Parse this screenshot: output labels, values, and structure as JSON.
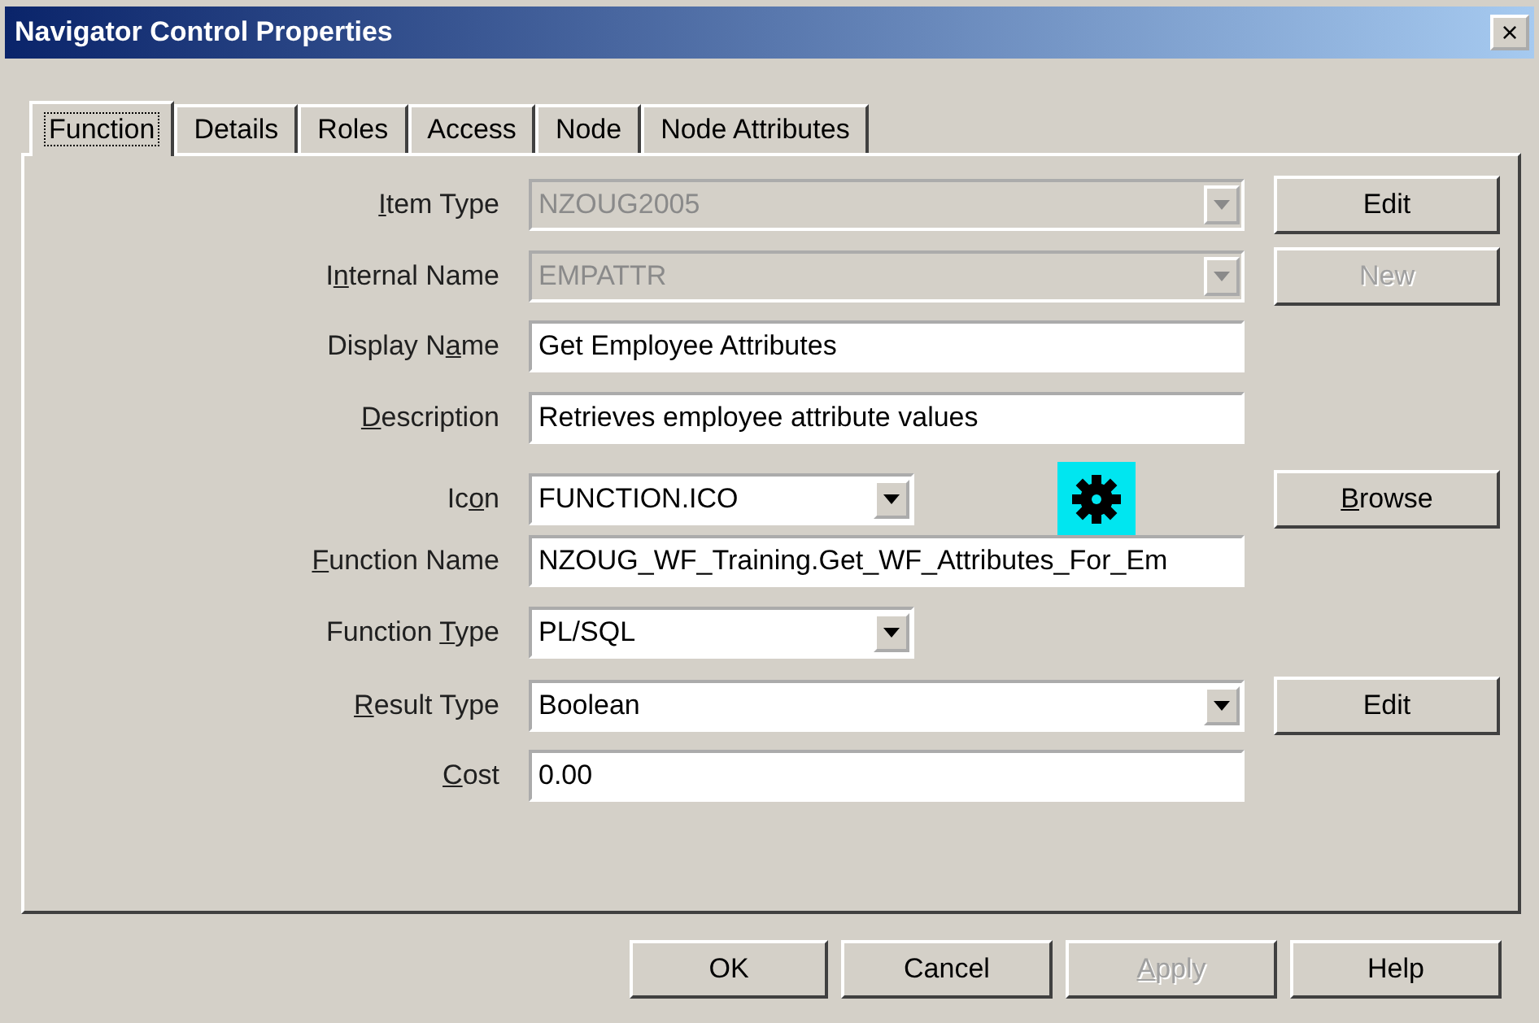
{
  "window": {
    "title": "Navigator Control Properties",
    "close": "×"
  },
  "tabs": [
    {
      "label": "Function",
      "selected": true
    },
    {
      "label": "Details",
      "selected": false
    },
    {
      "label": "Roles",
      "selected": false
    },
    {
      "label": "Access",
      "selected": false
    },
    {
      "label": "Node",
      "selected": false
    },
    {
      "label": "Node Attributes",
      "selected": false
    }
  ],
  "rows": [
    {
      "label": {
        "key": "I",
        "post": "tem Type"
      },
      "kind": "combo",
      "wide": true,
      "value": "NZOUG2005",
      "disabled": true,
      "button": {
        "label": {
          "pre": "Edit"
        },
        "disabled": false
      }
    },
    {
      "label": {
        "pre": "I",
        "key": "n",
        "post": "ternal Name"
      },
      "kind": "combo",
      "wide": true,
      "value": "EMPATTR",
      "disabled": true,
      "button": {
        "label": {
          "pre": "New"
        },
        "disabled": true
      }
    },
    {
      "label": {
        "pre": "Display N",
        "key": "a",
        "post": "me"
      },
      "kind": "text",
      "value": "Get Employee Attributes",
      "disabled": false
    },
    {
      "label": {
        "key": "D",
        "post": "escription"
      },
      "kind": "text",
      "value": "Retrieves employee attribute values",
      "disabled": false
    },
    {
      "label": {
        "pre": "Ic",
        "key": "o",
        "post": "n"
      },
      "kind": "combo",
      "wide": false,
      "value": "FUNCTION.ICO",
      "disabled": false,
      "preview": true,
      "button": {
        "label": {
          "key": "B",
          "post": "rowse"
        },
        "disabled": false
      }
    },
    {
      "label": {
        "key": "F",
        "post": "unction Name"
      },
      "kind": "text",
      "value": "NZOUG_WF_Training.Get_WF_Attributes_For_Em",
      "disabled": false
    },
    {
      "label": {
        "pre": "Function ",
        "key": "T",
        "post": "ype"
      },
      "kind": "combo",
      "wide": false,
      "value": "PL/SQL",
      "disabled": false
    },
    {
      "label": {
        "key": "R",
        "post": "esult Type"
      },
      "kind": "combo",
      "wide": true,
      "value": "Boolean",
      "disabled": false,
      "button": {
        "label": {
          "pre": "Edit"
        },
        "disabled": false
      }
    },
    {
      "label": {
        "key": "C",
        "post": "ost"
      },
      "kind": "text",
      "value": "0.00",
      "disabled": false
    }
  ],
  "buttons": [
    {
      "label": {
        "pre": "OK"
      },
      "disabled": false
    },
    {
      "label": {
        "pre": "Cancel"
      },
      "disabled": false
    },
    {
      "label": {
        "key": "A",
        "post": "pply"
      },
      "disabled": true
    },
    {
      "label": {
        "pre": "Help"
      },
      "disabled": false
    }
  ]
}
